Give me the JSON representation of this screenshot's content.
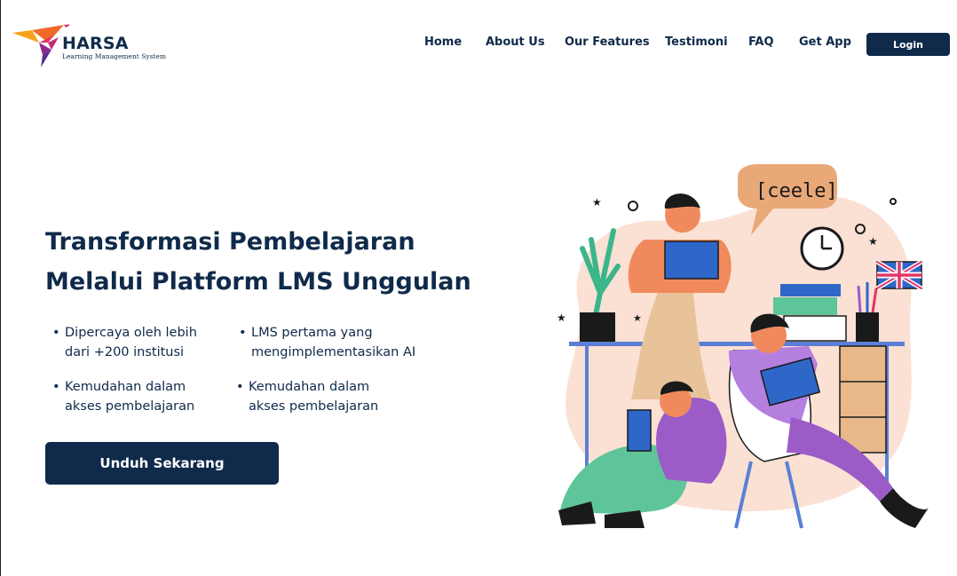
{
  "brand": {
    "name": "HARSA",
    "tagline": "Learning Management System"
  },
  "nav": {
    "items": [
      "Home",
      "About Us",
      "Our Features",
      "Testimoni",
      "FAQ",
      "Get App"
    ],
    "login_label": "Login"
  },
  "hero": {
    "headline_line1": "Transformasi Pembelajaran",
    "headline_line2": "Melalui Platform LMS Unggulan",
    "features": [
      {
        "line1": "Dipercaya oleh lebih",
        "line2": "dari +200 institusi"
      },
      {
        "line1": "LMS pertama yang",
        "line2": "mengimplementasikan AI"
      },
      {
        "line1": "Kemudahan dalam",
        "line2": "akses pembelajaran"
      },
      {
        "line1": "Kemudahan dalam",
        "line2": "akses pembelajaran"
      }
    ],
    "bullet": "•",
    "cta_label": "Unduh Sekarang"
  },
  "illustration": {
    "speech_bubble_text": "[ceele]"
  },
  "colors": {
    "primary": "#0f2a4a",
    "blob": "#fbe0d4",
    "accent_orange": "#f08a5d",
    "accent_purple": "#9b5cc7",
    "accent_green": "#5ec49a",
    "accent_blue": "#2f67c8"
  }
}
